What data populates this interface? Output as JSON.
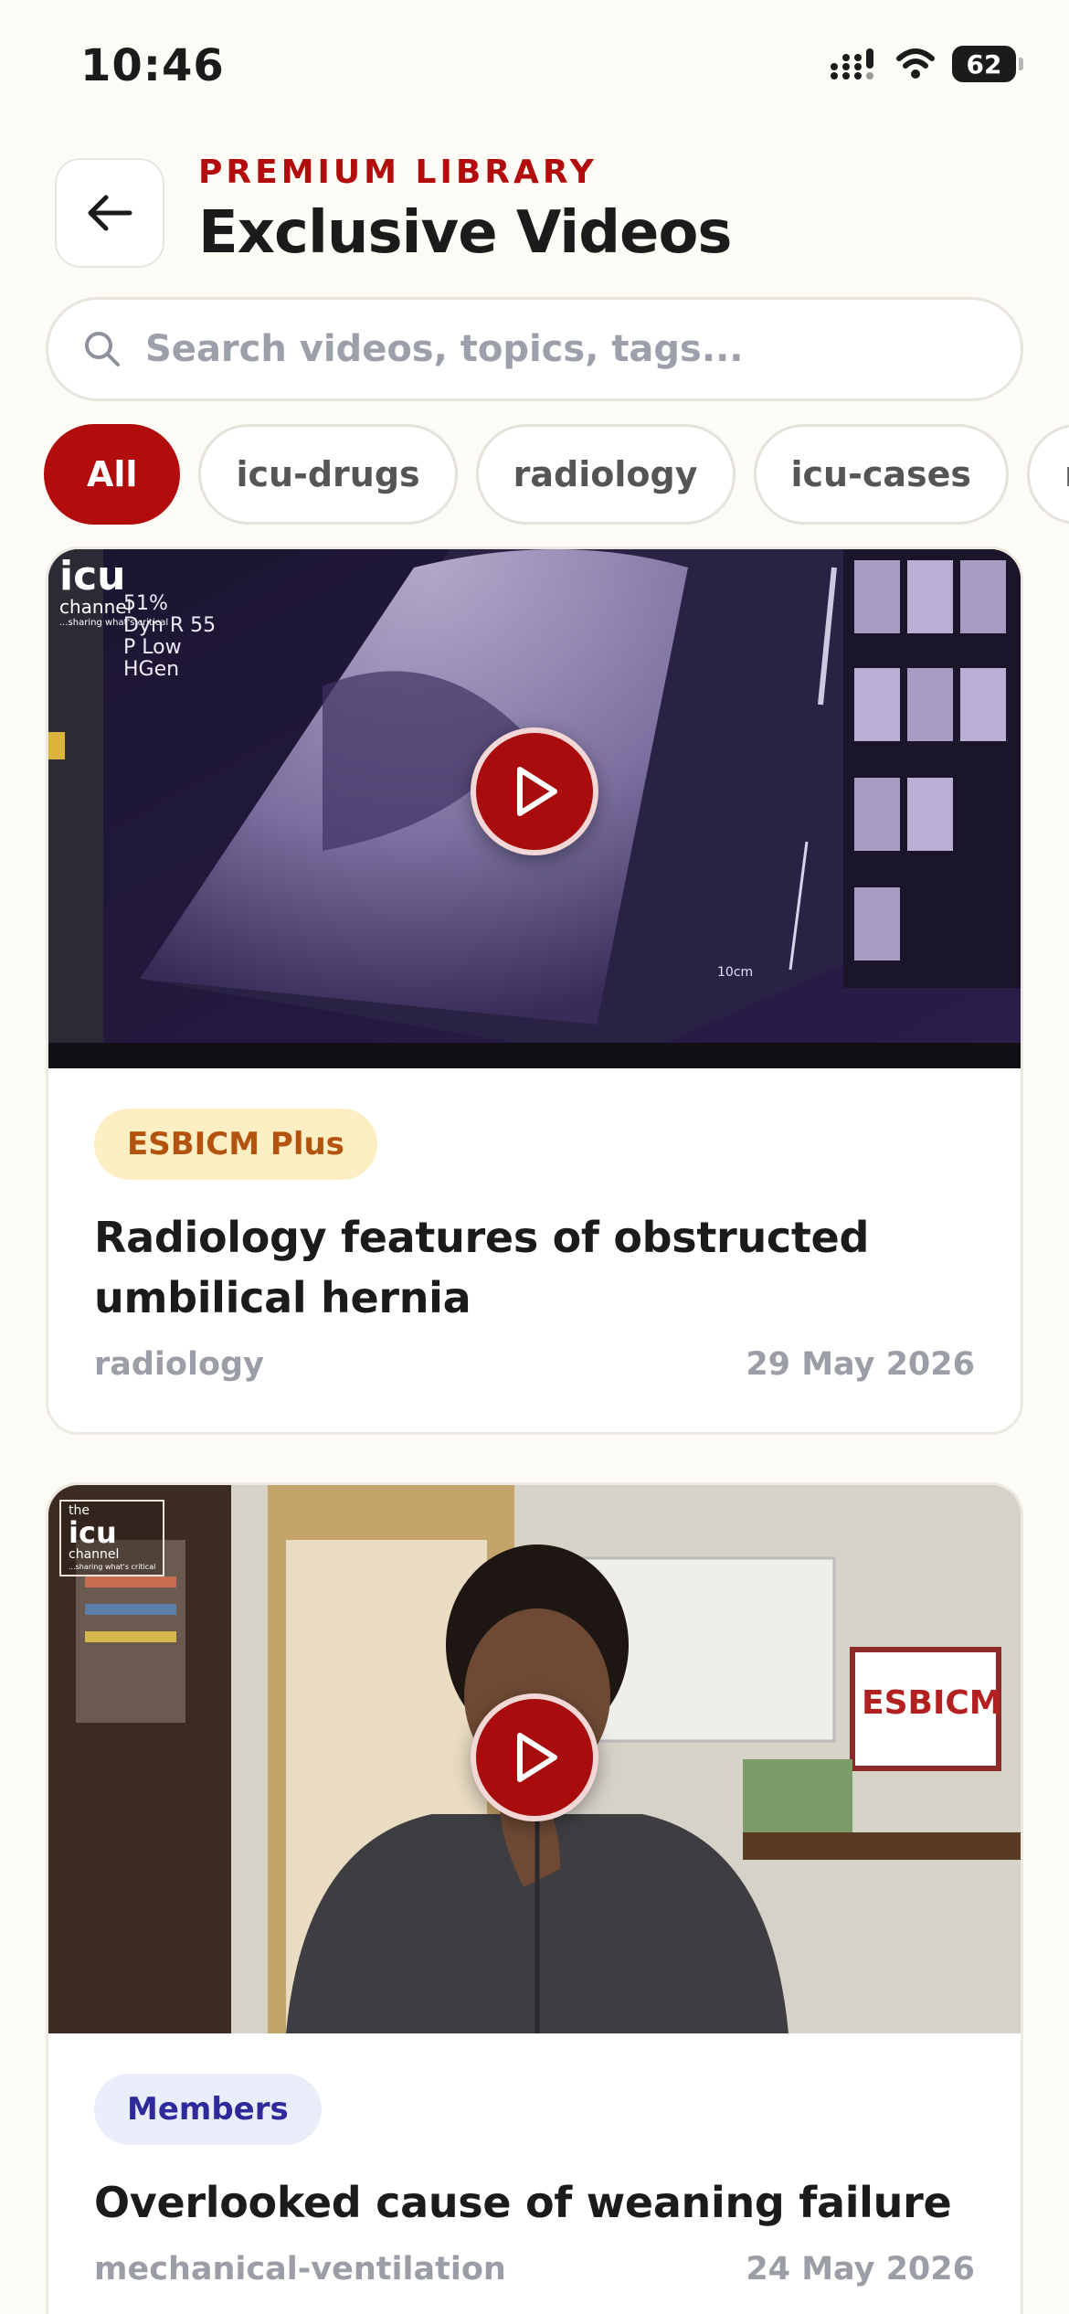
{
  "status_bar": {
    "time": "10:46",
    "battery": "62"
  },
  "header": {
    "eyebrow": "PREMIUM LIBRARY",
    "title": "Exclusive Videos"
  },
  "search": {
    "placeholder": "Search videos, topics, tags..."
  },
  "filters": [
    {
      "label": "All",
      "active": true
    },
    {
      "label": "icu-drugs",
      "active": false
    },
    {
      "label": "radiology",
      "active": false
    },
    {
      "label": "icu-cases",
      "active": false
    },
    {
      "label": "mechanical-ventilation",
      "active": false
    }
  ],
  "videos": [
    {
      "badge": "ESBICM Plus",
      "title": "Radiology features of obstructed umbilical hernia",
      "tag": "radiology",
      "date": "29 May 2026",
      "overlay": [
        "icu",
        "channel",
        "...sharing what's critical",
        "51%",
        "Dyn R 55",
        "P Low",
        "HGen",
        "10cm"
      ]
    },
    {
      "badge": "Members",
      "title": "Overlooked cause of weaning failure",
      "tag": "mechanical-ventilation",
      "date": "24 May 2026",
      "overlay": [
        "the",
        "icu",
        "channel",
        "...sharing what's critical",
        "ESBICM"
      ]
    }
  ],
  "colors": {
    "brand": "#b30c0c",
    "background": "#fcfbf6",
    "plus_badge_bg": "#fdefc3",
    "members_badge_bg": "#eaeefb"
  }
}
